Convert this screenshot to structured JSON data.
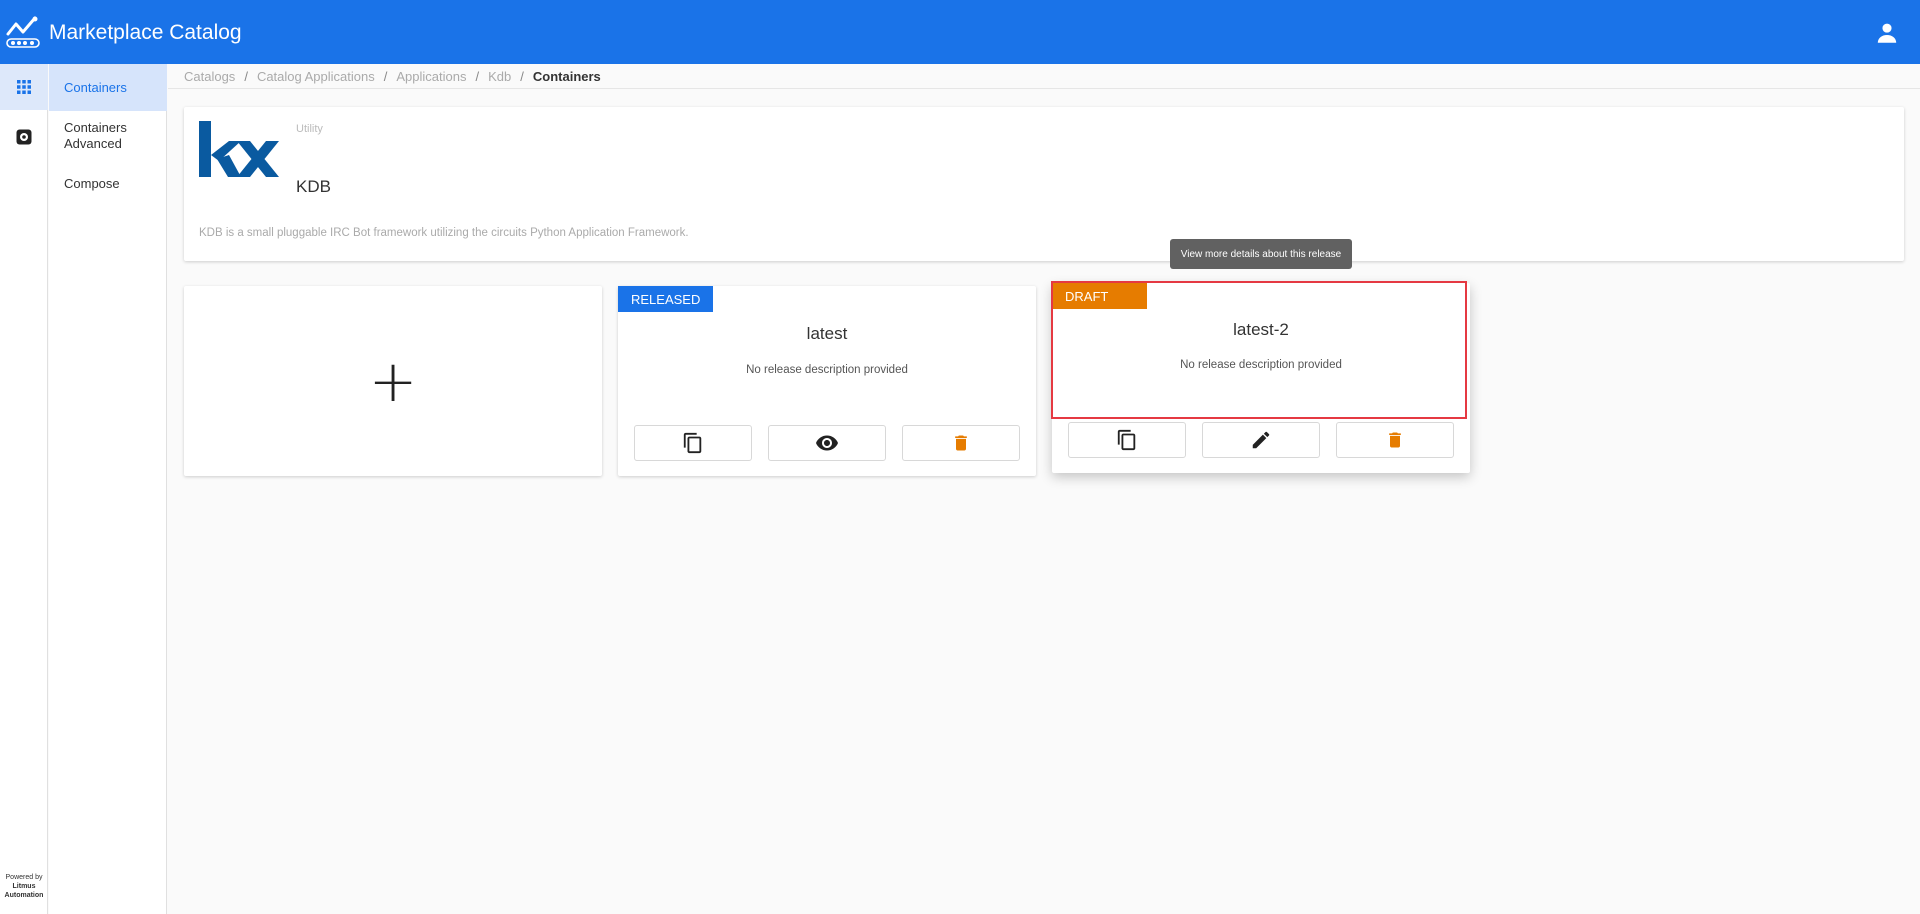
{
  "app": {
    "title": "Marketplace Catalog"
  },
  "rail": {
    "powered_by": "Powered by",
    "powered_company_line1": "Litmus",
    "powered_company_line2": "Automation"
  },
  "subnav": {
    "items": [
      {
        "label": "Containers"
      },
      {
        "label": "Containers Advanced"
      },
      {
        "label": "Compose"
      }
    ]
  },
  "breadcrumb": {
    "items": [
      "Catalogs",
      "Catalog Applications",
      "Applications",
      "Kdb",
      "Containers"
    ]
  },
  "application": {
    "category": "Utility",
    "name": "KDB",
    "description": "KDB is a small pluggable IRC Bot framework utilizing the circuits Python Application Framework.",
    "logo_text": "kx"
  },
  "releases": [
    {
      "status": "RELEASED",
      "title": "latest",
      "description": "No release description provided"
    },
    {
      "status": "DRAFT",
      "title": "latest-2",
      "description": "No release description provided"
    }
  ],
  "tooltip": {
    "text": "View more details about this release"
  },
  "colors": {
    "primary": "#1a73e8",
    "draft": "#e67c00",
    "delete": "#e67c00",
    "highlight": "#e53942"
  },
  "icons": {
    "copy": "copy-icon",
    "view": "eye-icon",
    "edit": "pencil-icon",
    "delete": "trash-icon",
    "user": "account-icon",
    "apps": "grid-icon",
    "settings": "gear-icon"
  }
}
